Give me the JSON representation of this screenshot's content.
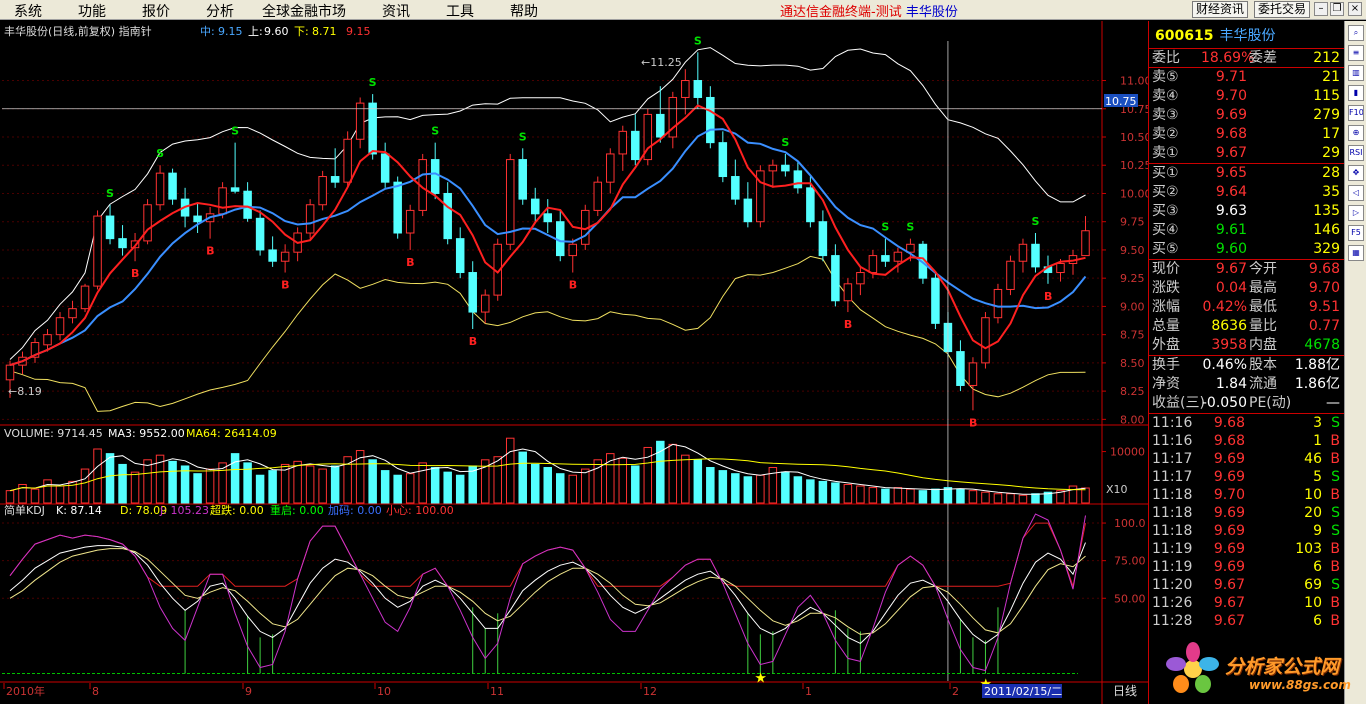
{
  "menu": {
    "items": [
      "系统",
      "功能",
      "报价",
      "分析",
      "全球金融市场",
      "资讯",
      "工具",
      "帮助"
    ],
    "title": "通达信金融终端-测试",
    "title_stock": "丰华股份",
    "btn_news": "财经资讯",
    "btn_trade": "委托交易"
  },
  "chart_data": [
    {
      "type": "candlestick",
      "title": "丰华股份(日线,前复权) 指南针",
      "legend": {
        "mid_label": "中:",
        "mid": "9.15",
        "up_label": "上:",
        "up": "9.60",
        "down_label": "下:",
        "down": "8.71",
        "extra": "9.15"
      },
      "yticks": [
        "11.00",
        "10.75",
        "10.50",
        "10.25",
        "10.00",
        "9.75",
        "9.50",
        "9.25",
        "9.00",
        "8.75",
        "8.50",
        "8.25",
        "8.00"
      ],
      "ylim": [
        7.95,
        11.35
      ],
      "crosshair_price": "10.75",
      "max_label": "11.25",
      "min_label": "8.19",
      "signals": {
        "S": "S",
        "B": "B"
      },
      "ohlc": [
        [
          8.35,
          8.52,
          8.19,
          8.48
        ],
        [
          8.48,
          8.6,
          8.4,
          8.55
        ],
        [
          8.55,
          8.72,
          8.5,
          8.68
        ],
        [
          8.66,
          8.8,
          8.6,
          8.75
        ],
        [
          8.75,
          8.95,
          8.7,
          8.9
        ],
        [
          8.9,
          9.05,
          8.85,
          8.98
        ],
        [
          8.98,
          9.2,
          8.95,
          9.18
        ],
        [
          9.18,
          9.85,
          9.15,
          9.8
        ],
        [
          9.8,
          9.9,
          9.55,
          9.6
        ],
        [
          9.6,
          9.72,
          9.45,
          9.52
        ],
        [
          9.52,
          9.65,
          9.4,
          9.58
        ],
        [
          9.58,
          9.95,
          9.55,
          9.9
        ],
        [
          9.9,
          10.25,
          9.85,
          10.18
        ],
        [
          10.18,
          10.22,
          9.9,
          9.95
        ],
        [
          9.95,
          10.05,
          9.7,
          9.8
        ],
        [
          9.8,
          9.92,
          9.65,
          9.75
        ],
        [
          9.75,
          9.88,
          9.6,
          9.82
        ],
        [
          9.82,
          10.1,
          9.78,
          10.05
        ],
        [
          10.05,
          10.45,
          10.0,
          10.02
        ],
        [
          10.02,
          10.1,
          9.75,
          9.78
        ],
        [
          9.78,
          9.85,
          9.45,
          9.5
        ],
        [
          9.5,
          9.62,
          9.35,
          9.4
        ],
        [
          9.4,
          9.55,
          9.3,
          9.48
        ],
        [
          9.48,
          9.7,
          9.4,
          9.65
        ],
        [
          9.65,
          9.95,
          9.6,
          9.9
        ],
        [
          9.9,
          10.2,
          9.85,
          10.15
        ],
        [
          10.15,
          10.4,
          10.05,
          10.1
        ],
        [
          10.1,
          10.55,
          10.05,
          10.48
        ],
        [
          10.48,
          10.85,
          10.4,
          10.8
        ],
        [
          10.8,
          10.88,
          10.3,
          10.35
        ],
        [
          10.35,
          10.45,
          10.05,
          10.1
        ],
        [
          10.1,
          10.15,
          9.6,
          9.65
        ],
        [
          9.65,
          9.9,
          9.5,
          9.85
        ],
        [
          9.85,
          10.35,
          9.8,
          10.3
        ],
        [
          10.3,
          10.45,
          9.95,
          10.0
        ],
        [
          10.0,
          10.1,
          9.55,
          9.6
        ],
        [
          9.6,
          9.7,
          9.25,
          9.3
        ],
        [
          9.3,
          9.4,
          8.8,
          8.95
        ],
        [
          8.95,
          9.15,
          8.85,
          9.1
        ],
        [
          9.1,
          9.6,
          9.05,
          9.55
        ],
        [
          9.55,
          10.35,
          9.5,
          10.3
        ],
        [
          10.3,
          10.4,
          9.9,
          9.95
        ],
        [
          9.95,
          10.05,
          9.75,
          9.82
        ],
        [
          9.82,
          9.95,
          9.65,
          9.75
        ],
        [
          9.75,
          9.85,
          9.4,
          9.45
        ],
        [
          9.45,
          9.6,
          9.3,
          9.55
        ],
        [
          9.55,
          9.9,
          9.5,
          9.85
        ],
        [
          9.85,
          10.15,
          9.8,
          10.1
        ],
        [
          10.1,
          10.4,
          10.0,
          10.35
        ],
        [
          10.35,
          10.6,
          10.2,
          10.55
        ],
        [
          10.55,
          10.7,
          10.25,
          10.3
        ],
        [
          10.3,
          10.75,
          10.25,
          10.7
        ],
        [
          10.7,
          10.95,
          10.45,
          10.5
        ],
        [
          10.5,
          10.9,
          10.4,
          10.85
        ],
        [
          10.85,
          11.1,
          10.7,
          11.0
        ],
        [
          11.0,
          11.25,
          10.75,
          10.85
        ],
        [
          10.85,
          10.95,
          10.4,
          10.45
        ],
        [
          10.45,
          10.55,
          10.1,
          10.15
        ],
        [
          10.15,
          10.3,
          9.9,
          9.95
        ],
        [
          9.95,
          10.1,
          9.7,
          9.75
        ],
        [
          9.75,
          10.25,
          9.7,
          10.2
        ],
        [
          10.2,
          10.3,
          10.05,
          10.25
        ],
        [
          10.25,
          10.35,
          10.15,
          10.2
        ],
        [
          10.2,
          10.28,
          10.0,
          10.05
        ],
        [
          10.05,
          10.15,
          9.7,
          9.75
        ],
        [
          9.75,
          9.85,
          9.4,
          9.45
        ],
        [
          9.45,
          9.55,
          9.0,
          9.05
        ],
        [
          9.05,
          9.25,
          8.95,
          9.2
        ],
        [
          9.2,
          9.35,
          9.1,
          9.3
        ],
        [
          9.3,
          9.5,
          9.25,
          9.45
        ],
        [
          9.45,
          9.6,
          9.35,
          9.4
        ],
        [
          9.4,
          9.52,
          9.3,
          9.48
        ],
        [
          9.48,
          9.6,
          9.4,
          9.55
        ],
        [
          9.55,
          9.58,
          9.2,
          9.25
        ],
        [
          9.25,
          9.3,
          8.8,
          8.85
        ],
        [
          8.85,
          8.95,
          8.55,
          8.6
        ],
        [
          8.6,
          8.7,
          8.25,
          8.3
        ],
        [
          8.3,
          8.55,
          8.08,
          8.5
        ],
        [
          8.5,
          8.95,
          8.45,
          8.9
        ],
        [
          8.9,
          9.2,
          8.85,
          9.15
        ],
        [
          9.15,
          9.45,
          9.1,
          9.4
        ],
        [
          9.4,
          9.6,
          9.3,
          9.55
        ],
        [
          9.55,
          9.65,
          9.3,
          9.35
        ],
        [
          9.35,
          9.45,
          9.2,
          9.3
        ],
        [
          9.3,
          9.42,
          9.22,
          9.38
        ],
        [
          9.38,
          9.5,
          9.28,
          9.45
        ],
        [
          9.45,
          9.8,
          9.51,
          9.67
        ]
      ]
    },
    {
      "type": "bar",
      "title_parts": [
        "VOLUME: 9714.45",
        "MA3: 9552.00",
        "MA64: 26414.09"
      ],
      "yticks": [
        "10000"
      ],
      "multiplier": "X10",
      "values": [
        800,
        1200,
        900,
        1500,
        1100,
        1400,
        2200,
        3500,
        3200,
        2500,
        2000,
        2800,
        3100,
        2700,
        2400,
        1900,
        2200,
        2600,
        3200,
        2600,
        1800,
        2100,
        2500,
        2700,
        2400,
        2200,
        2400,
        3000,
        3400,
        2800,
        2100,
        1800,
        1900,
        2600,
        2300,
        2000,
        1800,
        2400,
        2800,
        3000,
        4200,
        3300,
        2500,
        2300,
        1900,
        1800,
        2200,
        2800,
        3200,
        2900,
        2400,
        3600,
        4000,
        3800,
        3100,
        2800,
        2300,
        2100,
        1900,
        1700,
        1800,
        2300,
        2000,
        1700,
        1500,
        1400,
        1300,
        1200,
        1100,
        1000,
        900,
        1000,
        900,
        800,
        900,
        1000,
        900,
        800,
        700,
        600,
        600,
        500,
        600,
        700,
        800,
        1100,
        971
      ]
    },
    {
      "type": "line",
      "title": "简单KDJ",
      "params": [
        "K: 87.14",
        "D: 78.09",
        "J: 105.23",
        "超跌: 0.00",
        "重启: 0.00",
        "加码: 0.00",
        "小心: 100.00"
      ],
      "yticks": [
        "100.0",
        "75.00",
        "50.00"
      ],
      "ylim": [
        -5,
        112
      ],
      "series": [
        {
          "name": "K",
          "color": "#ffffff",
          "values": [
            55,
            62,
            70,
            75,
            80,
            82,
            84,
            85,
            85,
            84,
            80,
            72,
            60,
            50,
            42,
            48,
            58,
            60,
            50,
            38,
            28,
            24,
            30,
            45,
            60,
            70,
            76,
            74,
            68,
            60,
            50,
            44,
            48,
            58,
            62,
            58,
            50,
            40,
            30,
            30,
            42,
            55,
            62,
            68,
            72,
            74,
            70,
            62,
            52,
            44,
            40,
            44,
            50,
            56,
            62,
            66,
            68,
            62,
            52,
            40,
            30,
            26,
            30,
            38,
            44,
            40,
            32,
            24,
            20,
            28,
            40,
            52,
            60,
            62,
            58,
            48,
            36,
            26,
            20,
            26,
            42,
            60,
            74,
            80,
            76,
            66,
            87
          ]
        },
        {
          "name": "D",
          "color": "#f0e68c",
          "values": [
            50,
            55,
            62,
            68,
            74,
            78,
            80,
            82,
            83,
            83,
            81,
            76,
            68,
            60,
            52,
            50,
            54,
            57,
            55,
            48,
            40,
            33,
            31,
            36,
            46,
            56,
            65,
            70,
            69,
            65,
            58,
            52,
            50,
            54,
            58,
            58,
            54,
            48,
            40,
            35,
            38,
            46,
            54,
            61,
            66,
            70,
            70,
            66,
            60,
            52,
            46,
            45,
            47,
            52,
            57,
            61,
            64,
            63,
            58,
            50,
            42,
            35,
            32,
            35,
            40,
            40,
            37,
            31,
            26,
            27,
            33,
            42,
            51,
            57,
            58,
            54,
            46,
            37,
            29,
            27,
            33,
            45,
            58,
            69,
            73,
            71,
            78
          ]
        },
        {
          "name": "J",
          "color": "#cc33cc",
          "values": [
            65,
            76,
            86,
            89,
            92,
            90,
            92,
            91,
            89,
            86,
            78,
            64,
            44,
            30,
            22,
            44,
            66,
            66,
            40,
            18,
            4,
            6,
            28,
            63,
            88,
            98,
            98,
            82,
            66,
            50,
            34,
            28,
            44,
            66,
            70,
            58,
            42,
            24,
            10,
            20,
            50,
            73,
            78,
            82,
            84,
            82,
            70,
            54,
            36,
            28,
            28,
            42,
            56,
            64,
            72,
            76,
            76,
            60,
            40,
            20,
            6,
            8,
            26,
            44,
            52,
            40,
            22,
            10,
            8,
            30,
            54,
            72,
            78,
            72,
            58,
            36,
            16,
            4,
            2,
            24,
            60,
            90,
            106,
            102,
            82,
            56,
            105
          ]
        }
      ]
    }
  ],
  "xaxis": {
    "labels": [
      "2010年",
      "8",
      "9",
      "10",
      "11",
      "12",
      "1",
      "2"
    ],
    "crosshair_date": "2011/02/15/二",
    "period": "日线"
  },
  "quote": {
    "code": "600615",
    "name": "丰华股份",
    "wb": {
      "label": "委比",
      "value": "18.69%",
      "label2": "委差",
      "value2": "212"
    },
    "asks": [
      {
        "label": "卖⑤",
        "price": "9.71",
        "vol": "21"
      },
      {
        "label": "卖④",
        "price": "9.70",
        "vol": "115"
      },
      {
        "label": "卖③",
        "price": "9.69",
        "vol": "279"
      },
      {
        "label": "卖②",
        "price": "9.68",
        "vol": "17"
      },
      {
        "label": "卖①",
        "price": "9.67",
        "vol": "29"
      }
    ],
    "bids": [
      {
        "label": "买①",
        "price": "9.65",
        "vol": "28"
      },
      {
        "label": "买②",
        "price": "9.64",
        "vol": "35"
      },
      {
        "label": "买③",
        "price": "9.63",
        "vol": "135"
      },
      {
        "label": "买④",
        "price": "9.61",
        "vol": "146"
      },
      {
        "label": "买⑤",
        "price": "9.60",
        "vol": "329"
      }
    ],
    "stats": [
      {
        "l": "现价",
        "v": "9.67",
        "l2": "今开",
        "v2": "9.68"
      },
      {
        "l": "涨跌",
        "v": "0.04",
        "l2": "最高",
        "v2": "9.70"
      },
      {
        "l": "涨幅",
        "v": "0.42%",
        "l2": "最低",
        "v2": "9.51"
      },
      {
        "l": "总量",
        "v": "8636",
        "l2": "量比",
        "v2": "0.77"
      },
      {
        "l": "外盘",
        "v": "3958",
        "l2": "内盘",
        "v2": "4678"
      }
    ],
    "stats2": [
      {
        "l": "换手",
        "v": "0.46%",
        "l2": "股本",
        "v2": "1.88亿"
      },
      {
        "l": "净资",
        "v": "1.84",
        "l2": "流通",
        "v2": "1.86亿"
      },
      {
        "l": "收益(三)",
        "v": "-0.050",
        "l2": "PE(动)",
        "v2": "—"
      }
    ],
    "ticks": [
      {
        "t": "11:16",
        "p": "9.68",
        "v": "3",
        "s": "S"
      },
      {
        "t": "11:16",
        "p": "9.68",
        "v": "1",
        "s": "B"
      },
      {
        "t": "11:17",
        "p": "9.69",
        "v": "46",
        "s": "B"
      },
      {
        "t": "11:17",
        "p": "9.69",
        "v": "5",
        "s": "S"
      },
      {
        "t": "11:18",
        "p": "9.70",
        "v": "10",
        "s": "B"
      },
      {
        "t": "11:18",
        "p": "9.69",
        "v": "20",
        "s": "S"
      },
      {
        "t": "11:18",
        "p": "9.69",
        "v": "9",
        "s": "S"
      },
      {
        "t": "11:19",
        "p": "9.69",
        "v": "103",
        "s": "B"
      },
      {
        "t": "11:19",
        "p": "9.69",
        "v": "6",
        "s": "B"
      },
      {
        "t": "11:20",
        "p": "9.67",
        "v": "69",
        "s": "S"
      },
      {
        "t": "11:26",
        "p": "9.67",
        "v": "10",
        "s": "B"
      },
      {
        "t": "11:28",
        "p": "9.67",
        "v": "6",
        "s": "B"
      }
    ]
  },
  "logo": {
    "text": "分析家公式网",
    "url": "www.88gs.com"
  },
  "colors": {
    "up": "#ff3232",
    "down": "#54ffff",
    "ma_fast": "#ff2020",
    "ma_slow": "#3a8fff",
    "band": "#ffffff",
    "band_low": "#f0e060"
  }
}
